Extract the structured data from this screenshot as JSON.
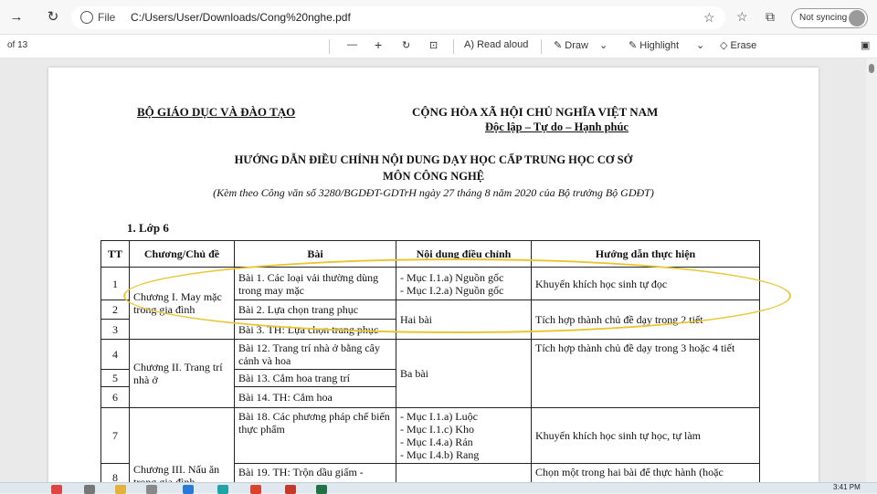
{
  "browser": {
    "address": {
      "scheme_label": "File",
      "url": "C:/Users/User/Downloads/Cong%20nghe.pdf"
    },
    "sync_label": "Not syncing"
  },
  "pdf_toolbar": {
    "page_of": "of 13",
    "read_aloud": "Read aloud",
    "draw": "Draw",
    "highlight": "Highlight",
    "erase": "Erase"
  },
  "document": {
    "header_left": "BỘ GIÁO DỤC VÀ ĐÀO TẠO",
    "header_right": "CỘNG HÒA XÃ HỘI CHỦ NGHĨA VIỆT NAM",
    "header_right_sub": "Độc lập – Tự do – Hạnh phúc",
    "title_line1": "HƯỚNG DẪN ĐIỀU CHỈNH NỘI DUNG DẠY HỌC CẤP TRUNG HỌC CƠ SỞ",
    "title_line2": "MÔN CÔNG NGHỆ",
    "title_line3": "(Kèm theo Công văn số 3280/BGDĐT-GDTrH ngày 27 tháng 8 năm 2020 của Bộ trưởng Bộ GDĐT)",
    "section": "1. Lớp 6",
    "table": {
      "headers": [
        "TT",
        "Chương/Chủ đề",
        "Bài",
        "Nội dung điều chỉnh",
        "Hướng dẫn thực hiện"
      ],
      "rows": {
        "r1": {
          "tt": "1",
          "chapter": "Chương I. May mặc trong gia đình",
          "lesson": "Bài 1. Các loại vải thường dùng trong may mặc",
          "adjust": "- Mục I.1.a) Nguồn gốc\n- Mục I.2.a) Nguồn gốc",
          "guide": "Khuyến khích học sinh tự đọc"
        },
        "r2": {
          "tt": "2",
          "lesson": "Bài 2. Lựa chọn trang phục",
          "adjust": "Hai bài",
          "guide": "Tích hợp thành chủ đề dạy trong 2 tiết"
        },
        "r3": {
          "tt": "3",
          "lesson": "Bài 3. TH: Lựa chọn trang phục"
        },
        "r4": {
          "tt": "4",
          "chapter": "Chương II. Trang trí nhà ở",
          "lesson": "Bài 12. Trang trí nhà ở bằng cây cảnh và hoa",
          "adjust": "Ba bài",
          "guide": "Tích hợp thành chủ đề dạy trong 3 hoặc 4 tiết"
        },
        "r5": {
          "tt": "5",
          "lesson": "Bài 13. Cắm hoa trang trí"
        },
        "r6": {
          "tt": "6",
          "lesson": "Bài 14. TH: Cắm hoa"
        },
        "r7": {
          "tt": "7",
          "chapter": "Chương III. Nấu ăn trong gia đình",
          "lesson": "Bài 18. Các phương pháp chế biến thực phẩm",
          "adjust": "- Mục I.1.a) Luộc\n- Mục I.1.c) Kho\n- Mục I.4.a) Rán\n- Mục I.4.b) Rang",
          "guide": "Khuyến khích học sinh tự học, tự làm"
        },
        "r8": {
          "tt": "8",
          "lesson": "Bài 19. TH: Trộn dầu giấm -",
          "guide": "Chọn một trong hai bài để thực hành (hoặc"
        }
      }
    }
  },
  "taskbar": {
    "clock": "3:41 PM"
  },
  "colors": {
    "annotation_ellipse": "#e8c532"
  }
}
